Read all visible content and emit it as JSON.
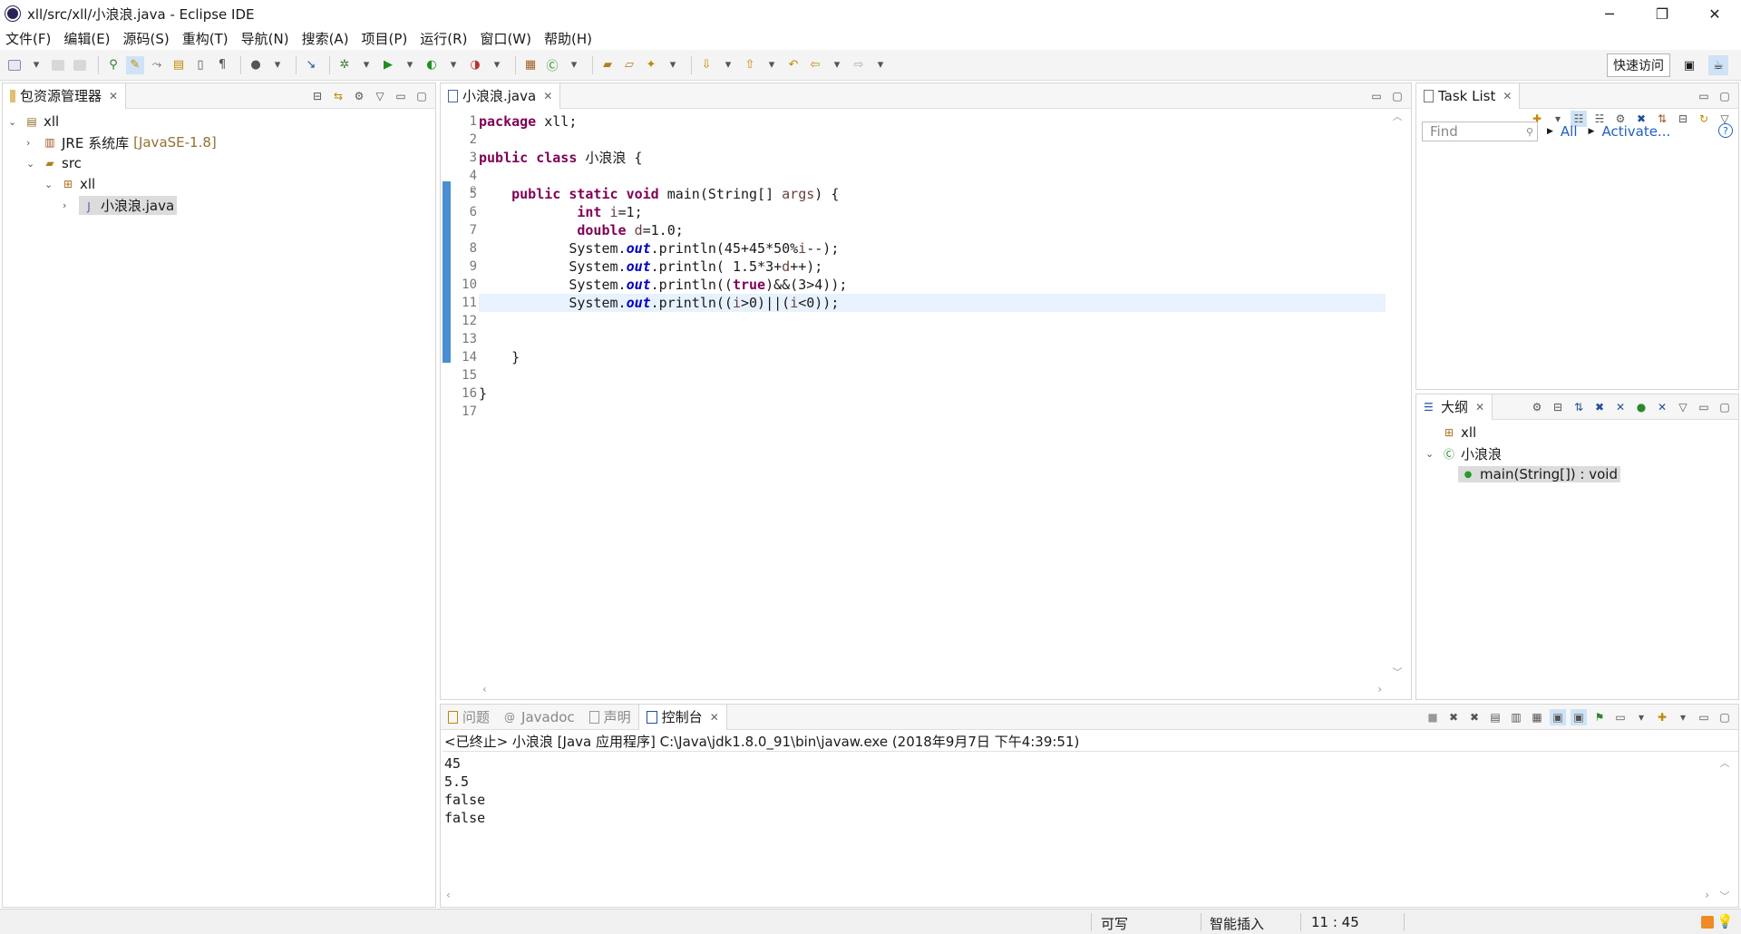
{
  "window": {
    "title": "xll/src/xll/小浪浪.java - Eclipse IDE",
    "controls": [
      "─",
      "❐",
      "✕"
    ]
  },
  "menu": [
    "文件(F)",
    "编辑(E)",
    "源码(S)",
    "重构(T)",
    "导航(N)",
    "搜索(A)",
    "项目(P)",
    "运行(R)",
    "窗口(W)",
    "帮助(H)"
  ],
  "toolbar": {
    "quick_access": "快速访问"
  },
  "explorer": {
    "tab": "包资源管理器",
    "project": "xll",
    "jre": "JRE 系统库",
    "jre_version": "[JavaSE-1.8]",
    "src": "src",
    "package": "xll",
    "file": "小浪浪.java"
  },
  "editor": {
    "tab": "小浪浪.java",
    "line_numbers": [
      "1",
      "2",
      "3",
      "4",
      "5",
      "6",
      "7",
      "8",
      "9",
      "10",
      "11",
      "12",
      "13",
      "14",
      "15",
      "16",
      "17"
    ]
  },
  "tasklist": {
    "tab": "Task List",
    "find_placeholder": "Find",
    "all": "All",
    "activate": "Activate..."
  },
  "outline": {
    "tab": "大纲",
    "package": "xll",
    "class": "小浪浪",
    "method": "main(String[]) : void"
  },
  "console": {
    "tabs": [
      "问题",
      "Javadoc",
      "声明",
      "控制台"
    ],
    "header": "<已终止> 小浪浪 [Java 应用程序] C:\\Java\\jdk1.8.0_91\\bin\\javaw.exe  (2018年9月7日 下午4:39:51)",
    "output": [
      "45",
      "5.5",
      "false",
      "false"
    ]
  },
  "status": {
    "writable": "可写",
    "insert_mode": "智能插入",
    "position": "11 : 45"
  },
  "colors": {
    "keyword": "#7f0055",
    "field": "#0000c0",
    "current_line": "#e8f2fe",
    "fold_bar": "#4a8fd1"
  }
}
